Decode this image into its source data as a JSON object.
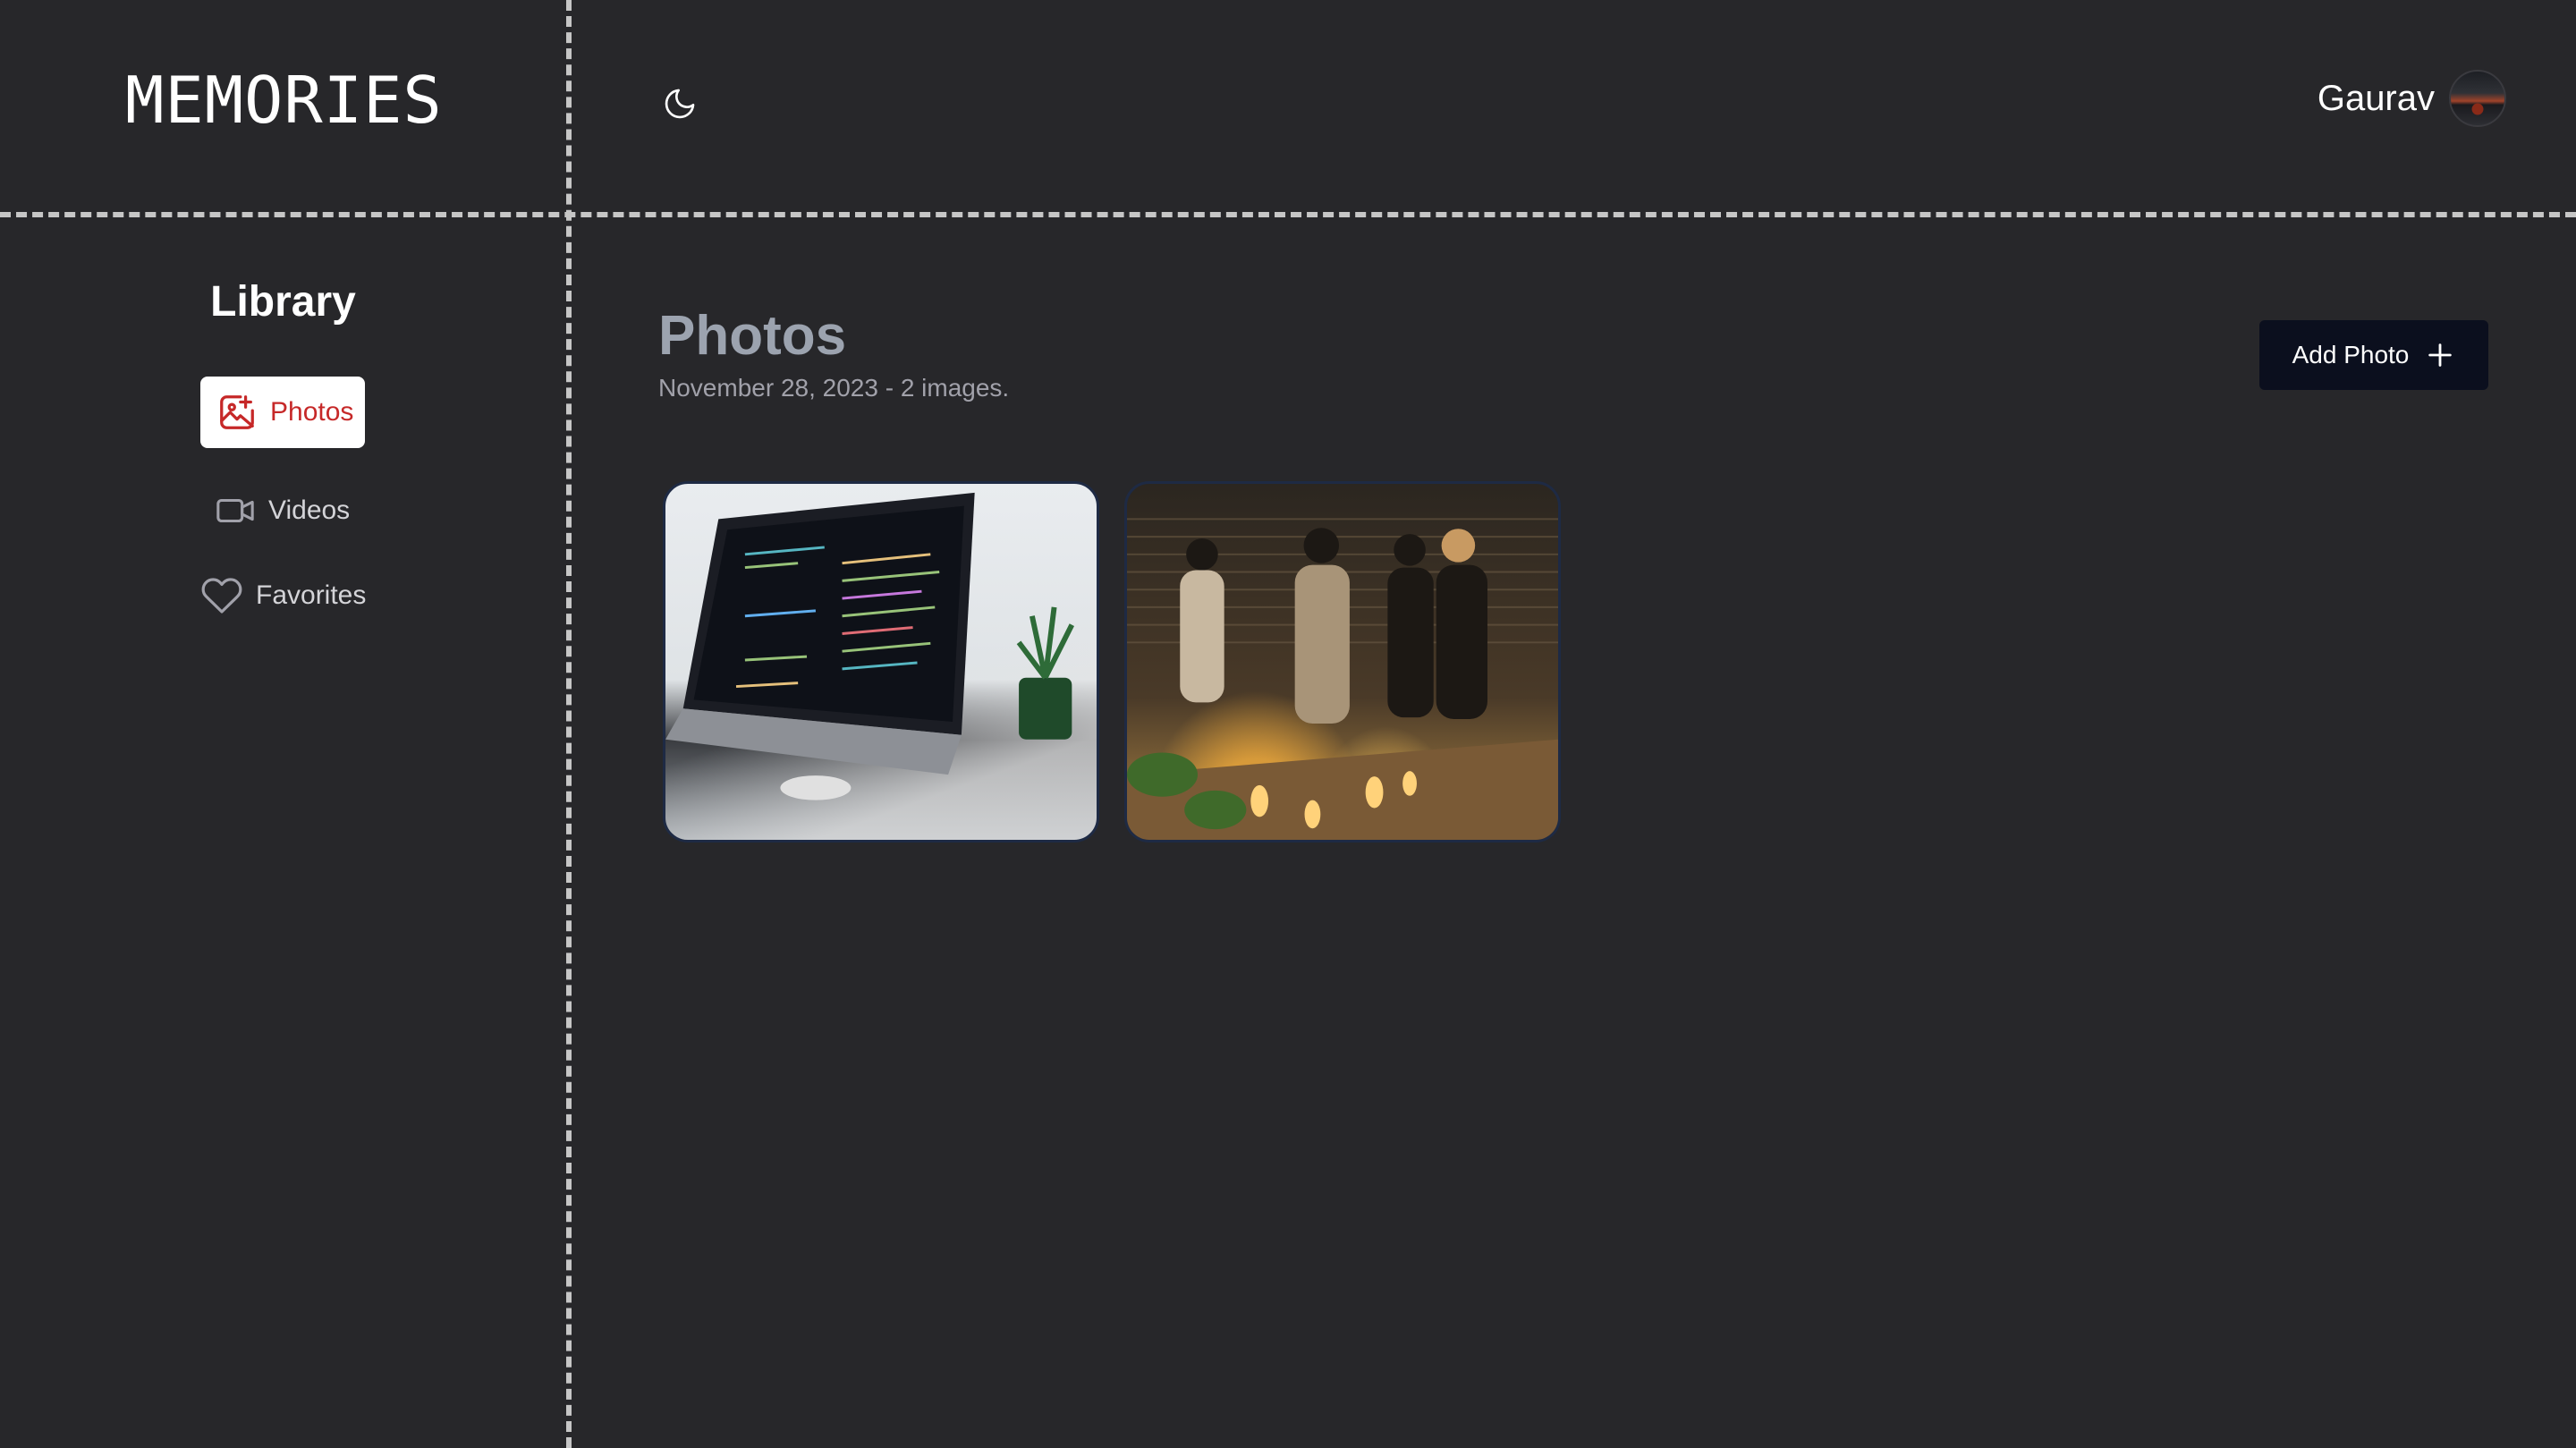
{
  "app": {
    "logo": "MEMORIES"
  },
  "header": {
    "theme_toggle_icon": "moon-icon",
    "user_name": "Gaurav",
    "avatar_icon": "avatar-image"
  },
  "sidebar": {
    "title": "Library",
    "items": [
      {
        "label": "Photos",
        "icon": "image-plus-icon",
        "active": true
      },
      {
        "label": "Videos",
        "icon": "video-camera-icon",
        "active": false
      },
      {
        "label": "Favorites",
        "icon": "heart-icon",
        "active": false
      }
    ]
  },
  "main": {
    "title": "Photos",
    "subtitle": "November 28, 2023 - 2 images.",
    "add_button_label": "Add Photo",
    "add_button_icon": "plus-icon",
    "photos": [
      {
        "subject": "laptop-with-code"
      },
      {
        "subject": "people-at-party"
      }
    ]
  },
  "colors": {
    "background": "#27272a",
    "active_nav_text": "#c62828",
    "button_bg": "#0b0f1e",
    "divider": "#c6c6c6"
  }
}
